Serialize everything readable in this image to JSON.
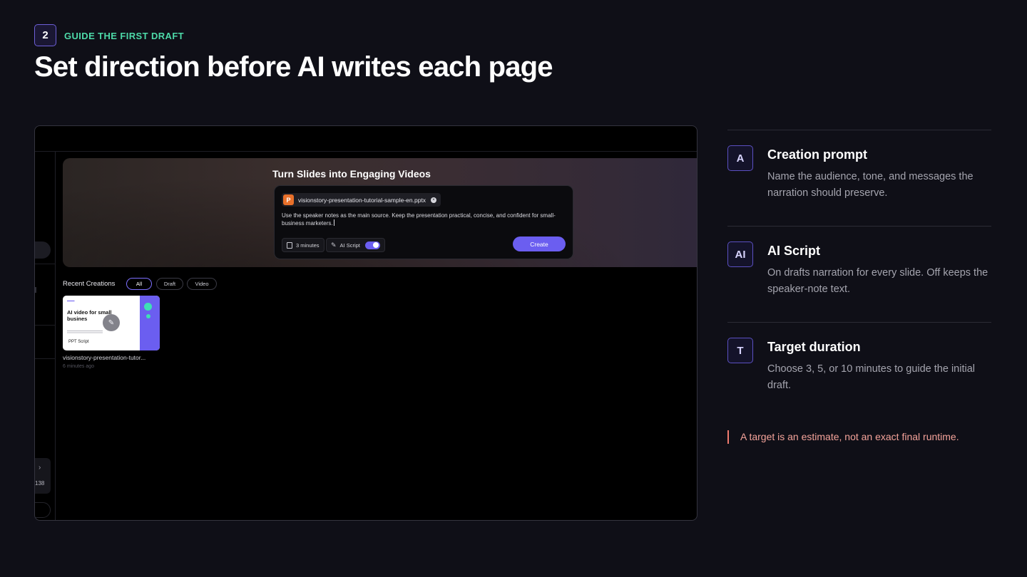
{
  "header": {
    "step_number": "2",
    "eyebrow": "GUIDE THE FIRST DRAFT",
    "headline": "Set direction before AI writes each page"
  },
  "app": {
    "sidebar": {
      "counter": "138",
      "icons": [
        "chevron-right-icon",
        "app-icon"
      ]
    },
    "hero": {
      "title": "Turn Slides into Engaging Videos",
      "file_icon_letter": "P",
      "file_name": "visionstory-presentation-tutorial-sample-en.pptx",
      "prompt_text": "Use the speaker notes as the main source. Keep the presentation practical, concise, and confident for small-business marketers.",
      "duration_label": "3 minutes",
      "ai_script_label": "AI Script",
      "ai_script_enabled": true,
      "create_label": "Create"
    },
    "recent": {
      "label": "Recent Creations",
      "filters": [
        "All",
        "Draft",
        "Video"
      ],
      "active_filter": "All",
      "items": [
        {
          "thumb_title": "AI video for small busines",
          "thumb_subtitle": "PPT Script",
          "name": "visionstory-presentation-tutor...",
          "time": "6 minutes ago"
        }
      ]
    }
  },
  "features": [
    {
      "badge": "A",
      "title": "Creation prompt",
      "description": "Name the audience, tone, and messages the narration should preserve."
    },
    {
      "badge": "AI",
      "title": "AI Script",
      "description": "On drafts narration for every slide. Off keeps the speaker-note text."
    },
    {
      "badge": "T",
      "title": "Target duration",
      "description": "Choose 3, 5, or 10 minutes to guide the initial draft."
    }
  ],
  "note": "A target is an estimate, not an exact final runtime.",
  "colors": {
    "background": "#0f0f17",
    "eyebrow": "#4dd9a8",
    "accent": "#6b5ef0",
    "note": "#f4a39a",
    "note_bar": "#f07a6e"
  }
}
